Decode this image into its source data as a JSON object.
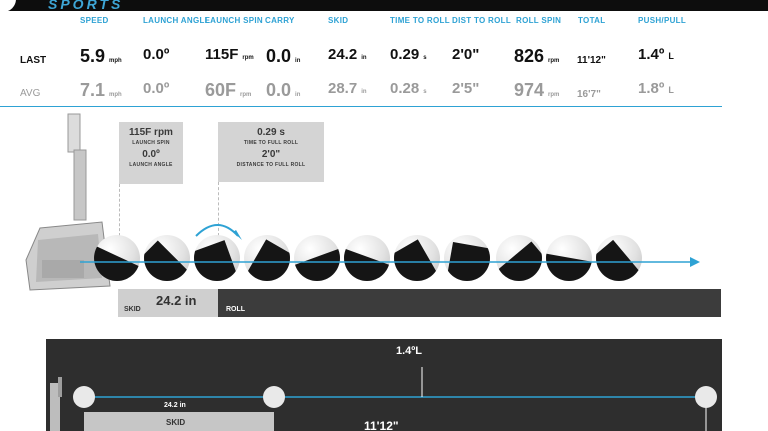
{
  "brand": {
    "name": "SPORTS"
  },
  "columns": [
    "SPEED",
    "LAUNCH ANGLE",
    "LAUNCH SPIN",
    "CARRY",
    "SKID",
    "TIME TO ROLL",
    "DIST TO ROLL",
    "ROLL SPIN",
    "TOTAL",
    "PUSH/PULL"
  ],
  "rows": [
    {
      "label": "LAST",
      "cells": [
        {
          "v": "5.9",
          "u": "mph"
        },
        {
          "v": "0.0º",
          "u": ""
        },
        {
          "v": "115F",
          "u": "rpm"
        },
        {
          "v": "0.0",
          "u": "in"
        },
        {
          "v": "24.2",
          "u": "in"
        },
        {
          "v": "0.29",
          "u": "s"
        },
        {
          "v": "2'0\"",
          "u": ""
        },
        {
          "v": "826",
          "u": "rpm"
        },
        {
          "v": "11'12\"",
          "u": ""
        },
        {
          "v": "1.4º",
          "u": "L"
        }
      ]
    },
    {
      "label": "AVG",
      "cells": [
        {
          "v": "7.1",
          "u": "mph"
        },
        {
          "v": "0.0º",
          "u": ""
        },
        {
          "v": "60F",
          "u": "rpm"
        },
        {
          "v": "0.0",
          "u": "in"
        },
        {
          "v": "28.7",
          "u": "in"
        },
        {
          "v": "0.28",
          "u": "s"
        },
        {
          "v": "2'5\"",
          "u": ""
        },
        {
          "v": "974",
          "u": "rpm"
        },
        {
          "v": "16'7\"",
          "u": ""
        },
        {
          "v": "1.8º",
          "u": "L"
        }
      ]
    }
  ],
  "launch_box": {
    "spin": "115F rpm",
    "spin_label": "LAUNCH SPIN",
    "angle": "0.0º",
    "angle_label": "LAUNCH ANGLE"
  },
  "roll_box": {
    "time": "0.29 s",
    "time_label": "TIME TO FULL ROLL",
    "dist": "2'0\"",
    "dist_label": "DISTANCE TO FULL ROLL"
  },
  "strip": {
    "skid_value": "24.2 in",
    "skid_label": "SKID",
    "roll_label": "ROLL"
  },
  "mini": {
    "push_pull": "1.4ºL",
    "skid_value": "24.2 in",
    "skid_label": "SKID",
    "total": "11'12\""
  },
  "colors": {
    "accent": "#2ea2d4",
    "dark": "#2e2e2e"
  }
}
